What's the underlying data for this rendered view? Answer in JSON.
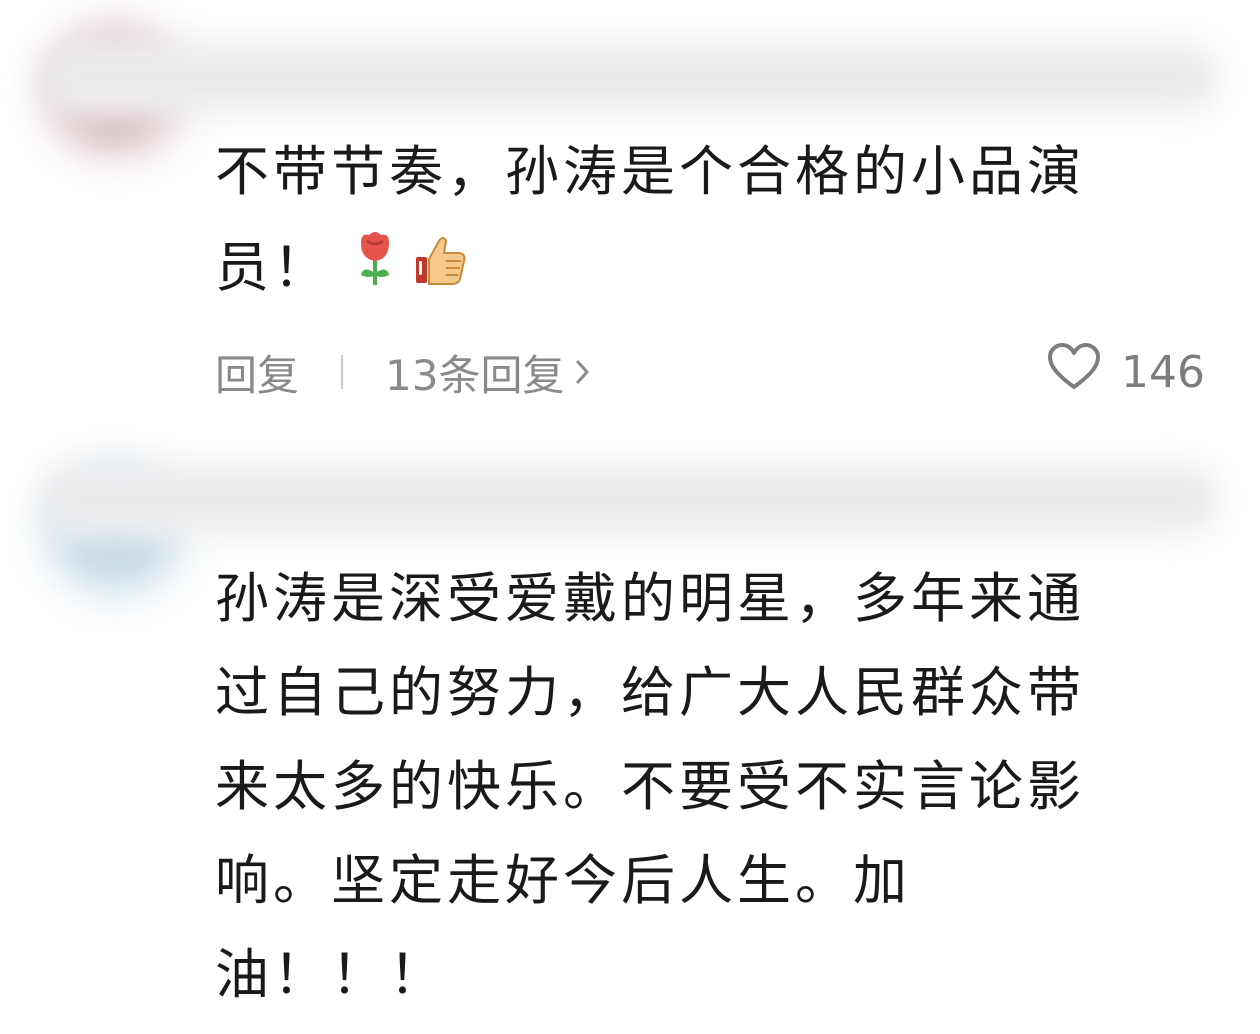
{
  "comments": [
    {
      "text_lines": [
        "不带节奏，孙涛是个合格的小品演",
        "员！"
      ],
      "emojis": [
        "rose-icon",
        "thumbs-up-icon"
      ],
      "reply_label": "回复",
      "replies_label": "13条回复",
      "like_count": "146"
    },
    {
      "text_lines": [
        "孙涛是深受爱戴的明星，多年来通",
        "过自己的努力，给广大人民群众带",
        "来太多的快乐。不要受不实言论影",
        "响。坚定走好今后人生。加",
        "油！！！"
      ]
    }
  ],
  "colors": {
    "text": "#1a1a1a",
    "secondary_text": "#8a8a8a",
    "divider": "#c9c9c9",
    "rose_red": "#e5534b",
    "leaf_green": "#4caf50",
    "thumb_skin": "#f6c98a"
  }
}
